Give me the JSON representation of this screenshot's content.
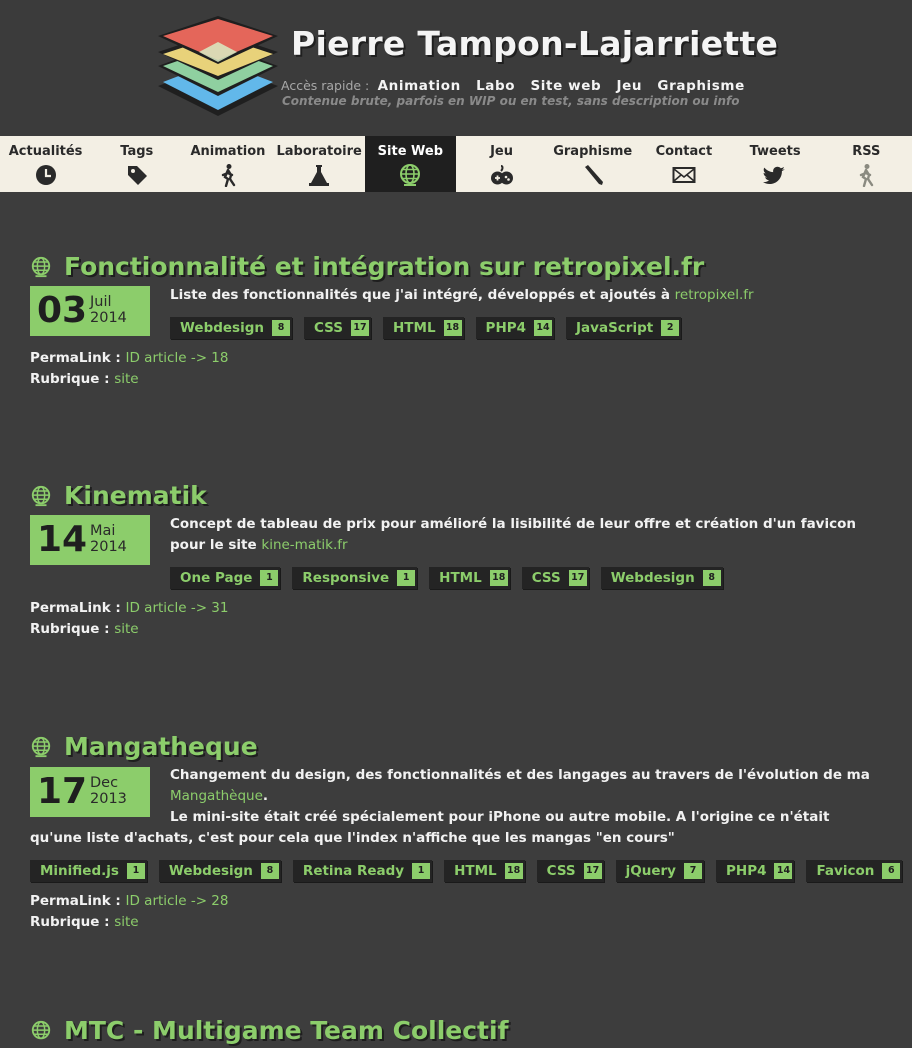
{
  "header": {
    "title": "Pierre Tampon-Lajarriette",
    "quick_label": "Accès rapide :",
    "quick_links": [
      "Animation",
      "Labo",
      "Site web",
      "Jeu",
      "Graphisme"
    ],
    "tagline": "Contenue brute, parfois en WIP ou en test, sans description ou info"
  },
  "nav": [
    {
      "label": "Actualités",
      "icon": "clock-icon"
    },
    {
      "label": "Tags",
      "icon": "tag-icon"
    },
    {
      "label": "Animation",
      "icon": "walking-person-icon"
    },
    {
      "label": "Laboratoire",
      "icon": "lab-flask-icon"
    },
    {
      "label": "Site Web",
      "icon": "globe-icon",
      "active": true
    },
    {
      "label": "Jeu",
      "icon": "gamepad-icon"
    },
    {
      "label": "Graphisme",
      "icon": "pencil-icon"
    },
    {
      "label": "Contact",
      "icon": "envelope-icon"
    },
    {
      "label": "Tweets",
      "icon": "bird-icon"
    },
    {
      "label": "RSS",
      "icon": "walking-person-icon"
    }
  ],
  "colors": {
    "accent": "#8ccd6b",
    "background": "#3d3d3d",
    "nav_bg": "#f3efe4",
    "tag_bg": "#242424"
  },
  "articles": [
    {
      "title": "Fonctionnalité et intégration sur retropixel.fr",
      "day": "03",
      "month": "Juil",
      "year": "2014",
      "desc": {
        "text": "Liste des fonctionnalités que j'ai intégré, développés et ajoutés à ",
        "link": "retropixel.fr"
      },
      "tags": [
        {
          "name": "Webdesign",
          "count": "8"
        },
        {
          "name": "CSS",
          "count": "17"
        },
        {
          "name": "HTML",
          "count": "18"
        },
        {
          "name": "PHP4",
          "count": "14"
        },
        {
          "name": "JavaScript",
          "count": "2"
        }
      ],
      "permalink_label": "PermaLink :",
      "permalink": "ID article -> 18",
      "rubrique_label": "Rubrique :",
      "rubrique": "site"
    },
    {
      "title": "Kinematik",
      "day": "14",
      "month": "Mai",
      "year": "2014",
      "desc": {
        "text": "Concept de tableau de prix pour amélioré la lisibilité de leur offre et création d'un favicon pour le site ",
        "link": "kine-matik.fr"
      },
      "tags": [
        {
          "name": "One Page",
          "count": "1"
        },
        {
          "name": "Responsive",
          "count": "1"
        },
        {
          "name": "HTML",
          "count": "18"
        },
        {
          "name": "CSS",
          "count": "17"
        },
        {
          "name": "Webdesign",
          "count": "8"
        }
      ],
      "permalink_label": "PermaLink :",
      "permalink": "ID article -> 31",
      "rubrique_label": "Rubrique :",
      "rubrique": "site"
    },
    {
      "title": "Mangatheque",
      "day": "17",
      "month": "Dec",
      "year": "2013",
      "desc": {
        "text": "Changement du design, des fonctionnalités et des langages au travers de l'évolution de ma ",
        "link": "Mangathèque",
        "after": "."
      },
      "desc2": "Le mini-site était créé spécialement pour iPhone ou autre mobile. A l'origine ce n'était qu'une liste d'achats, c'est pour cela que l'index n'affiche que les mangas \"en cours\"",
      "tags": [
        {
          "name": "Minified.js",
          "count": "1"
        },
        {
          "name": "Webdesign",
          "count": "8"
        },
        {
          "name": "Retina Ready",
          "count": "1"
        },
        {
          "name": "HTML",
          "count": "18"
        },
        {
          "name": "CSS",
          "count": "17"
        },
        {
          "name": "jQuery",
          "count": "7"
        },
        {
          "name": "PHP4",
          "count": "14"
        },
        {
          "name": "Favicon",
          "count": "6"
        }
      ],
      "permalink_label": "PermaLink :",
      "permalink": "ID article -> 28",
      "rubrique_label": "Rubrique :",
      "rubrique": "site"
    },
    {
      "title": "MTC - Multigame Team Collectif"
    }
  ]
}
